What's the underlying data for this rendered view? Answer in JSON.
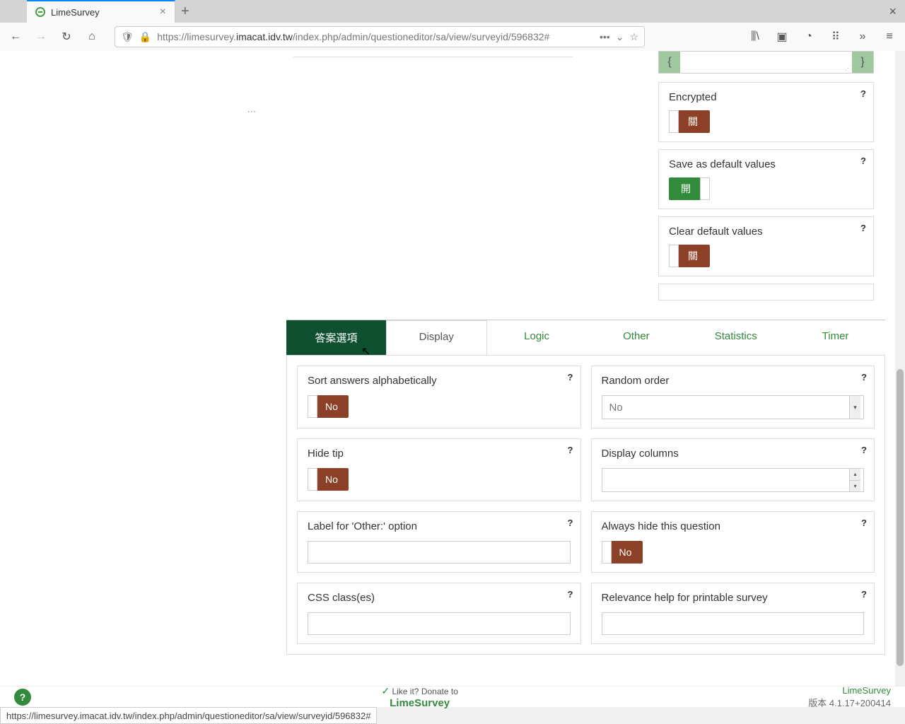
{
  "browser": {
    "tab_title": "LimeSurvey",
    "url_prefix": "https://limesurvey.",
    "url_domain": "imacat.idv.tw",
    "url_suffix": "/index.php/admin/questioneditor/sa/view/surveyid/596832#"
  },
  "sidebar": {
    "encrypted": {
      "label": "Encrypted",
      "value": "關"
    },
    "save_default": {
      "label": "Save as default values",
      "value": "開"
    },
    "clear_default": {
      "label": "Clear default values",
      "value": "關"
    }
  },
  "tabs": {
    "answers": "答案選項",
    "display": "Display",
    "logic": "Logic",
    "other": "Other",
    "statistics": "Statistics",
    "timer": "Timer"
  },
  "options": {
    "sort_alpha": {
      "label": "Sort answers alphabetically",
      "value": "No"
    },
    "random_order": {
      "label": "Random order",
      "value": "No"
    },
    "hide_tip": {
      "label": "Hide tip",
      "value": "No"
    },
    "display_cols": {
      "label": "Display columns",
      "value": ""
    },
    "other_label": {
      "label": "Label for 'Other:' option",
      "value": ""
    },
    "always_hide": {
      "label": "Always hide this question",
      "value": "No"
    },
    "css_classes": {
      "label": "CSS class(es)",
      "value": ""
    },
    "relevance_help": {
      "label": "Relevance help for printable survey",
      "value": ""
    }
  },
  "footer": {
    "like_it": "Like it?",
    "donate": "Donate to",
    "limesurvey": "LimeSurvey",
    "brand": "LimeSurvey",
    "version": "版本 4.1.17+200414"
  },
  "status_url": "https://limesurvey.imacat.idv.tw/index.php/admin/questioneditor/sa/view/surveyid/596832#"
}
